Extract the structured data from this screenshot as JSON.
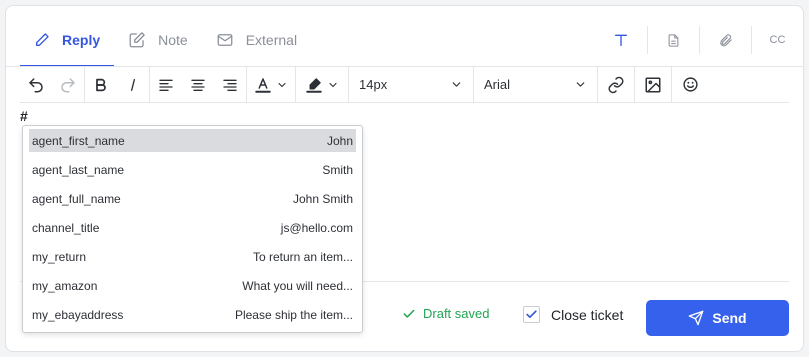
{
  "tabs": [
    {
      "label": "Reply",
      "icon": "pencil-icon",
      "active": true
    },
    {
      "label": "Note",
      "icon": "edit-note-icon",
      "active": false
    },
    {
      "label": "External",
      "icon": "mail-icon",
      "active": false
    }
  ],
  "top_right": {
    "cc_label": "CC",
    "icons": [
      "text-format-icon",
      "document-icon",
      "paperclip-icon"
    ]
  },
  "toolbar": {
    "font_size": "14px",
    "font_family": "Arial"
  },
  "editor": {
    "content": "#"
  },
  "suggestions": [
    {
      "key": "agent_first_name",
      "value": "John",
      "selected": true
    },
    {
      "key": "agent_last_name",
      "value": "Smith",
      "selected": false
    },
    {
      "key": "agent_full_name",
      "value": "John Smith",
      "selected": false
    },
    {
      "key": "channel_title",
      "value": "js@hello.com",
      "selected": false
    },
    {
      "key": "my_return",
      "value": "To return an item...",
      "selected": false
    },
    {
      "key": "my_amazon",
      "value": "What you will need...",
      "selected": false
    },
    {
      "key": "my_ebayaddress",
      "value": "Please ship the item...",
      "selected": false
    }
  ],
  "footer": {
    "draft_status": "Draft saved",
    "close_ticket_label": "Close ticket",
    "close_ticket_checked": true,
    "send_label": "Send"
  },
  "colors": {
    "accent": "#3661ec",
    "success": "#22a454"
  }
}
